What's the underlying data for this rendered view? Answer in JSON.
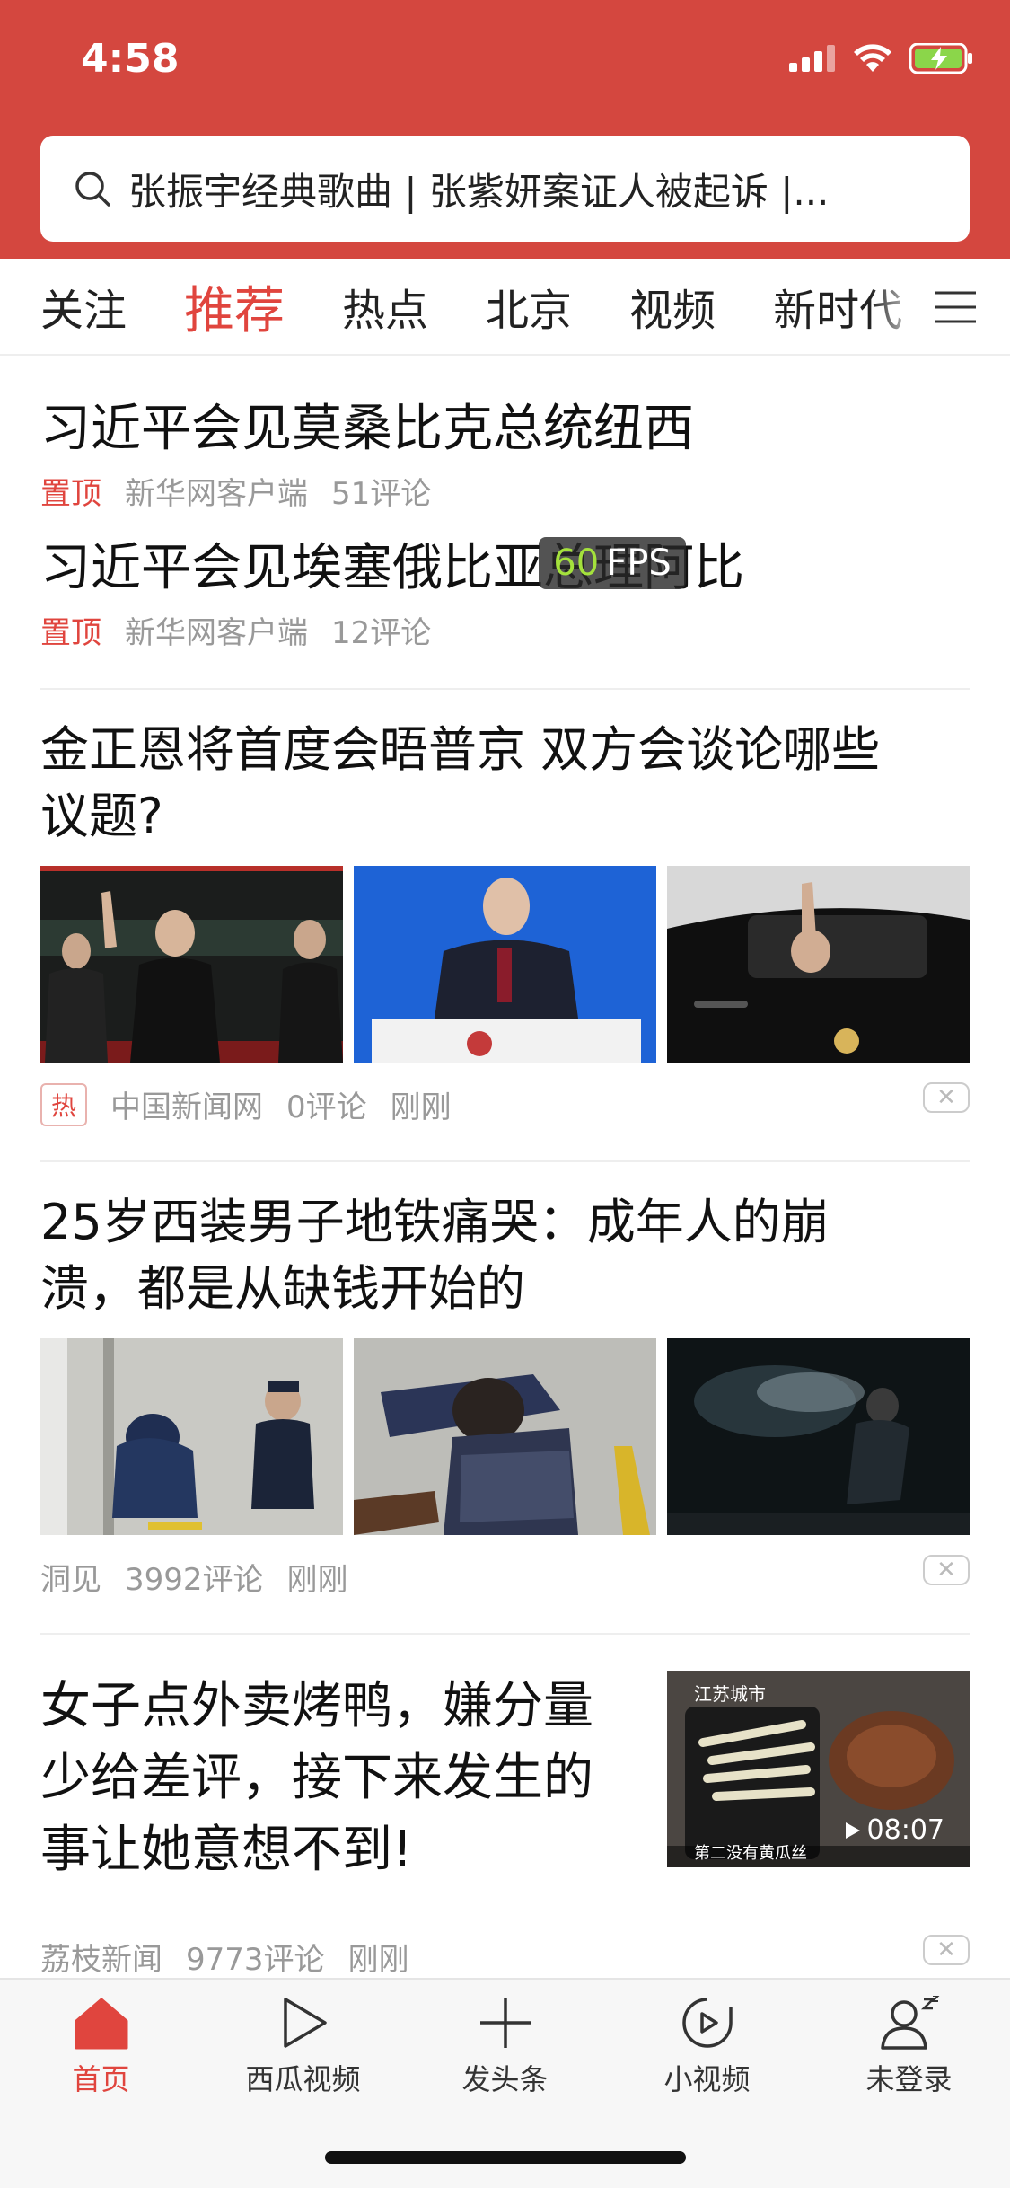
{
  "status": {
    "time": "4:58"
  },
  "search": {
    "text": "张振宇经典歌曲 | 张紫妍案证人被起诉 |..."
  },
  "tabs": [
    {
      "label": "关注"
    },
    {
      "label": "推荐"
    },
    {
      "label": "热点"
    },
    {
      "label": "北京"
    },
    {
      "label": "视频"
    },
    {
      "label": "新时代"
    }
  ],
  "pinned": [
    {
      "title": "习近平会见莫桑比克总统纽西",
      "tag": "置顶",
      "source": "新华网客户端",
      "comments": "51评论"
    },
    {
      "title": "习近平会见埃塞俄比亚总理阿比",
      "tag": "置顶",
      "source": "新华网客户端",
      "comments": "12评论"
    }
  ],
  "overlay": {
    "fps_value": "60",
    "fps_unit": "FPS"
  },
  "articles": [
    {
      "title": "金正恩将首度会晤普京 双方会谈论哪些议题?",
      "tag": "热",
      "source": "中国新闻网",
      "comments": "0评论",
      "time": "刚刚"
    },
    {
      "title": "25岁西装男子地铁痛哭：成年人的崩溃，都是从缺钱开始的",
      "source": "洞见",
      "comments": "3992评论",
      "time": "刚刚"
    },
    {
      "title": "女子点外卖烤鸭，嫌分量少给差评，接下来发生的事让她意想不到!",
      "source": "荔枝新闻",
      "comments": "9773评论",
      "time": "刚刚",
      "video_duration": "08:07",
      "thumb_logo": "江苏城市",
      "thumb_caption": "第二没有黄瓜丝"
    }
  ],
  "bottom_nav": [
    {
      "label": "首页",
      "icon": "home-icon"
    },
    {
      "label": "西瓜视频",
      "icon": "play-icon"
    },
    {
      "label": "发头条",
      "icon": "plus-icon"
    },
    {
      "label": "小视频",
      "icon": "small-video-icon"
    },
    {
      "label": "未登录",
      "icon": "user-icon"
    }
  ],
  "colors": {
    "brand_red": "#d4473f",
    "accent_red": "#e0453e",
    "battery_green": "#8bd64a"
  }
}
